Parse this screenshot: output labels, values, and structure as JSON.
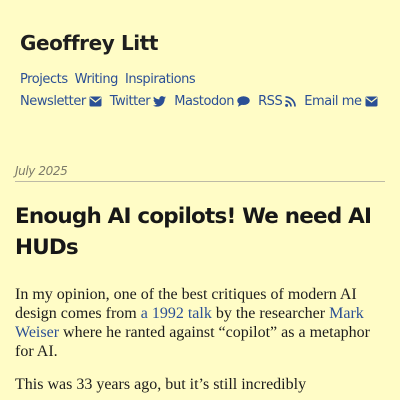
{
  "site": {
    "title": "Geoffrey Litt"
  },
  "nav": {
    "primary": [
      {
        "label": "Projects"
      },
      {
        "label": "Writing"
      },
      {
        "label": "Inspirations"
      }
    ],
    "social": [
      {
        "label": "Newsletter",
        "icon": "envelope-icon"
      },
      {
        "label": "Twitter",
        "icon": "twitter-bird-icon"
      },
      {
        "label": "Mastodon",
        "icon": "speech-bubble-icon"
      },
      {
        "label": "RSS",
        "icon": "rss-icon"
      },
      {
        "label": "Email me",
        "icon": "envelope-icon"
      }
    ]
  },
  "post": {
    "date": "July 2025",
    "title": "Enough AI copilots! We need AI HUDs",
    "paragraph1": {
      "text_a": "In my opinion, one of the best critiques of modern AI design comes from ",
      "link1": "a 1992 talk",
      "text_b": " by the researcher ",
      "link2": "Mark Weiser",
      "text_c": " where he ranted against “copilot” as a metaphor for AI."
    },
    "paragraph2": {
      "text": "This was 33 years ago, but it’s still incredibly"
    }
  },
  "colors": {
    "background": "#fffcc6",
    "link": "#2b4f95",
    "text": "#1c1c1c",
    "date": "#7d7b6a"
  }
}
